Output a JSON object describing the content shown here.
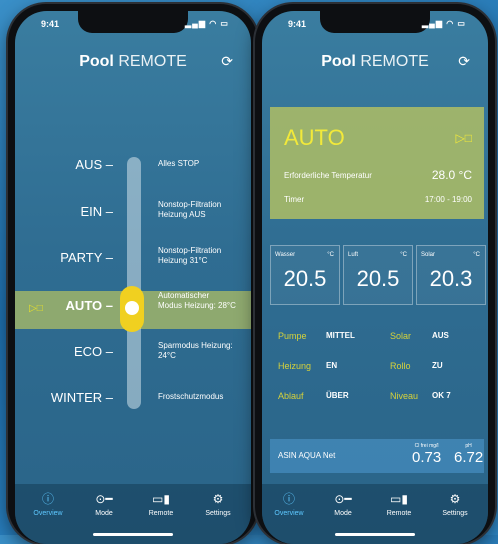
{
  "left": {
    "status_time": "9:41",
    "title_bold": "Pool",
    "title_light": "REMOTE",
    "modes": [
      {
        "label": "AUS",
        "desc1": "Alles STOP",
        "desc2": ""
      },
      {
        "label": "EIN",
        "desc1": "Nonstop-Filtration",
        "desc2": "Heizung AUS"
      },
      {
        "label": "PARTY",
        "desc1": "Nonstop-Filtration",
        "desc2": "Heizung 31°C"
      },
      {
        "label": "AUTO",
        "desc1": "Automatischer",
        "desc2": "Modus Heizung: 28°C"
      },
      {
        "label": "ECO",
        "desc1": "Sparmodus Heizung:",
        "desc2": "24°C"
      },
      {
        "label": "WINTER",
        "desc1": "Frostschutzmodus",
        "desc2": ""
      }
    ],
    "play_stop": "▷□",
    "tabs": [
      {
        "label": "Overview",
        "icon": "i"
      },
      {
        "label": "Mode",
        "icon": "toggle"
      },
      {
        "label": "Remote",
        "icon": "remote"
      },
      {
        "label": "Settings",
        "icon": "gear"
      }
    ]
  },
  "right": {
    "status_time": "9:41",
    "title_bold": "Pool",
    "title_light": "REMOTE",
    "mode": "AUTO",
    "play_stop": "▷□",
    "required_temp_label": "Erforderliche Temperatur",
    "required_temp_value": "28.0 °C",
    "timer_label": "Timer",
    "timer_value": "17:00 - 19:00",
    "temps": [
      {
        "label": "Wasser",
        "unit": "°C",
        "value": "20.5"
      },
      {
        "label": "Luft",
        "unit": "°C",
        "value": "20.5"
      },
      {
        "label": "Solar",
        "unit": "°C",
        "value": "20.3"
      }
    ],
    "status": [
      {
        "k1": "Pumpe",
        "v1": "MITTEL",
        "k2": "Solar",
        "v2": "AUS"
      },
      {
        "k1": "Heizung",
        "v1": "EN",
        "k2": "Rollo",
        "v2": "ZU"
      },
      {
        "k1": "Ablauf",
        "v1": "ÜBER",
        "k2": "Niveau",
        "v2": "OK 7"
      }
    ],
    "asin_name": "ASIN AQUA Net",
    "asin_m1_unit": "Cl frei mg/l",
    "asin_m1_value": "0.73",
    "asin_m2_unit": "pH",
    "asin_m2_value": "6.72",
    "tabs": [
      {
        "label": "Overview",
        "icon": "i"
      },
      {
        "label": "Mode",
        "icon": "toggle"
      },
      {
        "label": "Remote",
        "icon": "remote"
      },
      {
        "label": "Settings",
        "icon": "gear"
      }
    ]
  },
  "colors": {
    "accent_yellow": "#f2e93a",
    "active_tab": "#5ec8ff",
    "highlight_green": "#afbe64"
  }
}
